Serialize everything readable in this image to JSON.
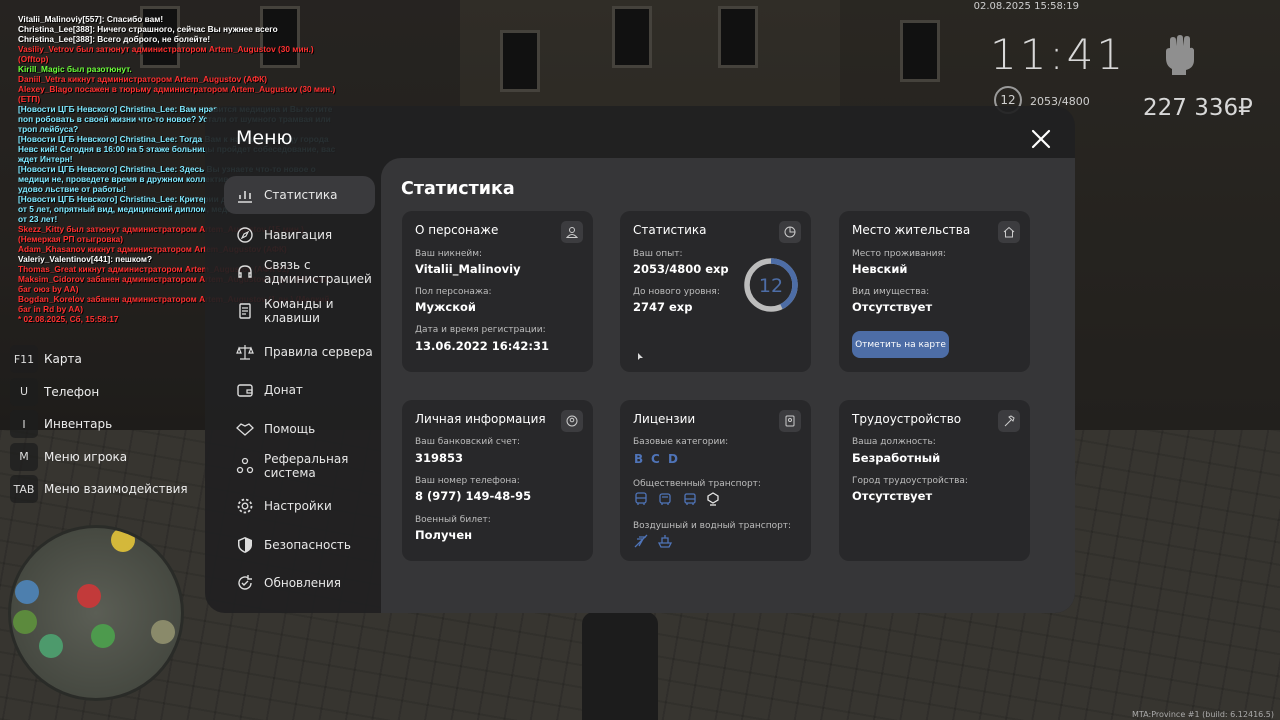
{
  "hud": {
    "datetime": "02.08.2025 15:58:19",
    "time": "11:41",
    "level": "12",
    "exp": "2053/4800",
    "money": "227 336₽"
  },
  "chat": [
    {
      "text": "Vitalii_Malinoviy[557]: Спасибо вам!",
      "color": "#ffffff"
    },
    {
      "text": "Christina_Lee[388]: Ничего страшного, сейчас Вы нужнее всего",
      "color": "#ffffff"
    },
    {
      "text": "Christina_Lee[388]: Всего доброго, не болейте!",
      "color": "#ffffff"
    },
    {
      "text": "Vasiliy_Vetrov был затюнут администратором Artem_Augustov (30 мин.) (Offtop)",
      "color": "#ff3030"
    },
    {
      "text": "Kirill_Magic был разотюнут.",
      "color": "#6cff3a"
    },
    {
      "text": "Daniil_Vetra кикнут администратором Artem_Augustov (АФК)",
      "color": "#ff3030"
    },
    {
      "text": "Alexey_Blago посажен в тюрьму администратором Artem_Augustov (30 мин.) (ЕТП)",
      "color": "#ff3030"
    },
    {
      "text": "[Новости ЦГБ Невского] Christina_Lee: Вам нравится медицина и Вы хотите поп робовать в своей жизни что-то новое? Устали от шумного трамвая или троп лейбуса?",
      "color": "#7ee8ff"
    },
    {
      "text": "[Новости ЦГБ Невского] Christina_Lee: Тогда Вам к нам, в больницу города Невс кий! Сегодня в 16:00 на 5 этаже больницы пройдет собеседование, вас ждет Интерн!",
      "color": "#7ee8ff"
    },
    {
      "text": "[Новости ЦГБ Невского] Christina_Lee: Здесь Вы узнаете что-то новое о медици не, проведете время в дружном коллективе, ну и конечно получите удово льствие от работы!",
      "color": "#7ee8ff"
    },
    {
      "text": "[Новости ЦГБ Невского] Christina_Lee: Критерии для кандидатов: прописка от 5 лет, опрятный вид, медицинский диплом, медицинская карта, возраст от 23 лет!",
      "color": "#7ee8ff"
    },
    {
      "text": "Skezz_Kitty был затюнут администратором Artem_Augustov (15 мин.) (Немеркая РП отыгровка)",
      "color": "#ff3030"
    },
    {
      "text": "Adam_Khasanov кикнут администратором Artem_Augustov (АФК)",
      "color": "#ff3030"
    },
    {
      "text": "Valeriy_Valentinov[441]: пешком?",
      "color": "#ffffff"
    },
    {
      "text": "Thomas_Great кикнут администратором Artem_Augustov (АФК 01)",
      "color": "#ff3030"
    },
    {
      "text": "Maksim_Cidorov забанен администратором Artem_Augustov (1 дн.) (Мелкий баг оюз by AA)",
      "color": "#ff3030"
    },
    {
      "text": "Bogdan_Korelov забанен администратором Artem_Augustov (1 дн.) (Мелкий баг in Rd by AA)",
      "color": "#ff3030"
    },
    {
      "text": "* 02.08.2025, Сб, 15:58:17",
      "color": "#ff3030"
    }
  ],
  "hotkeys": [
    {
      "key": "F11",
      "label": "Карта"
    },
    {
      "key": "U",
      "label": "Телефон"
    },
    {
      "key": "I",
      "label": "Инвентарь"
    },
    {
      "key": "M",
      "label": "Меню игрока"
    },
    {
      "key": "TAB",
      "label": "Меню взаимодействия"
    }
  ],
  "menu": {
    "title": "Меню",
    "nav": [
      {
        "label": "Статистика",
        "icon": "chart-icon"
      },
      {
        "label": "Навигация",
        "icon": "compass-icon"
      },
      {
        "label": "Связь с администрацией",
        "icon": "headset-icon"
      },
      {
        "label": "Команды и клавиши",
        "icon": "document-icon"
      },
      {
        "label": "Правила сервера",
        "icon": "scales-icon"
      },
      {
        "label": "Донат",
        "icon": "wallet-icon"
      },
      {
        "label": "Помощь",
        "icon": "handshake-icon"
      },
      {
        "label": "Реферальная система",
        "icon": "referral-icon"
      },
      {
        "label": "Настройки",
        "icon": "gear-icon"
      },
      {
        "label": "Безопасность",
        "icon": "shield-icon"
      },
      {
        "label": "Обновления",
        "icon": "refresh-icon"
      }
    ]
  },
  "panel": {
    "title": "Статистика",
    "character": {
      "title": "О персонаже",
      "nick_label": "Ваш никнейм:",
      "nick": "Vitalii_Malinoviy",
      "gender_label": "Пол персонажа:",
      "gender": "Мужской",
      "reg_label": "Дата и время регистрации:",
      "reg": "13.06.2022 16:42:31"
    },
    "stats": {
      "title": "Статистика",
      "exp_label": "Ваш опыт:",
      "exp": "2053/4800 exp",
      "next_label": "До нового уровня:",
      "next": "2747 exp",
      "level": "12",
      "progress": 0.4277
    },
    "residence": {
      "title": "Место жительства",
      "place_label": "Место проживания:",
      "place": "Невский",
      "property_label": "Вид имущества:",
      "property": "Отсутствует",
      "map_button": "Отметить на карте"
    },
    "personal": {
      "title": "Личная информация",
      "bank_label": "Ваш банковский счет:",
      "bank": "319853",
      "phone_label": "Ваш номер телефона:",
      "phone": "8 (977) 149-48-95",
      "military_label": "Военный билет:",
      "military": "Получен"
    },
    "licenses": {
      "title": "Лицензии",
      "basic_label": "Базовые категории:",
      "categories": [
        "B",
        "C",
        "D"
      ],
      "public_label": "Общественный транспорт:",
      "air_label": "Воздушный и водный транспорт:"
    },
    "employment": {
      "title": "Трудоустройство",
      "position_label": "Ваша должность:",
      "position": "Безработный",
      "city_label": "Город трудоустройства:",
      "city": "Отсутствует"
    }
  },
  "footer": {
    "build": "MTA:Province #1 (build: 6.12416.5)"
  },
  "colors": {
    "accent": "#4d6da6",
    "card": "#28282a",
    "panel": "#363638",
    "menu": "#202021"
  }
}
